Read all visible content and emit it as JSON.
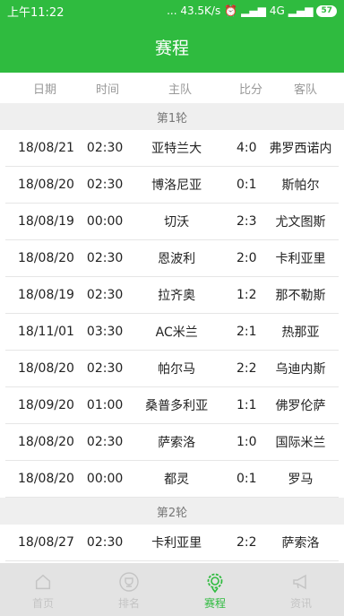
{
  "status_bar": {
    "time": "上午11:22",
    "network": "... 43.5K/s",
    "signal_text": "4G",
    "battery": "57"
  },
  "title": "赛程",
  "columns": {
    "date": "日期",
    "time": "时间",
    "home": "主队",
    "score": "比分",
    "away": "客队"
  },
  "rounds": [
    {
      "label": "第1轮",
      "matches": [
        {
          "date": "18/08/21",
          "time": "02:30",
          "home": "亚特兰大",
          "score": "4:0",
          "away": "弗罗西诺内"
        },
        {
          "date": "18/08/20",
          "time": "02:30",
          "home": "博洛尼亚",
          "score": "0:1",
          "away": "斯帕尔"
        },
        {
          "date": "18/08/19",
          "time": "00:00",
          "home": "切沃",
          "score": "2:3",
          "away": "尤文图斯"
        },
        {
          "date": "18/08/20",
          "time": "02:30",
          "home": "恩波利",
          "score": "2:0",
          "away": "卡利亚里"
        },
        {
          "date": "18/08/19",
          "time": "02:30",
          "home": "拉齐奥",
          "score": "1:2",
          "away": "那不勒斯"
        },
        {
          "date": "18/11/01",
          "time": "03:30",
          "home": "AC米兰",
          "score": "2:1",
          "away": "热那亚"
        },
        {
          "date": "18/08/20",
          "time": "02:30",
          "home": "帕尔马",
          "score": "2:2",
          "away": "乌迪内斯"
        },
        {
          "date": "18/09/20",
          "time": "01:00",
          "home": "桑普多利亚",
          "score": "1:1",
          "away": "佛罗伦萨"
        },
        {
          "date": "18/08/20",
          "time": "02:30",
          "home": "萨索洛",
          "score": "1:0",
          "away": "国际米兰"
        },
        {
          "date": "18/08/20",
          "time": "00:00",
          "home": "都灵",
          "score": "0:1",
          "away": "罗马"
        }
      ]
    },
    {
      "label": "第2轮",
      "matches": [
        {
          "date": "18/08/27",
          "time": "02:30",
          "home": "卡利亚里",
          "score": "2:2",
          "away": "萨索洛"
        }
      ]
    }
  ],
  "nav": [
    {
      "label": "首页",
      "icon": "home-icon",
      "active": false
    },
    {
      "label": "排名",
      "icon": "trophy-icon",
      "active": false
    },
    {
      "label": "赛程",
      "icon": "schedule-icon",
      "active": true
    },
    {
      "label": "资讯",
      "icon": "megaphone-icon",
      "active": false
    }
  ],
  "colors": {
    "accent": "#2fbb3f"
  }
}
